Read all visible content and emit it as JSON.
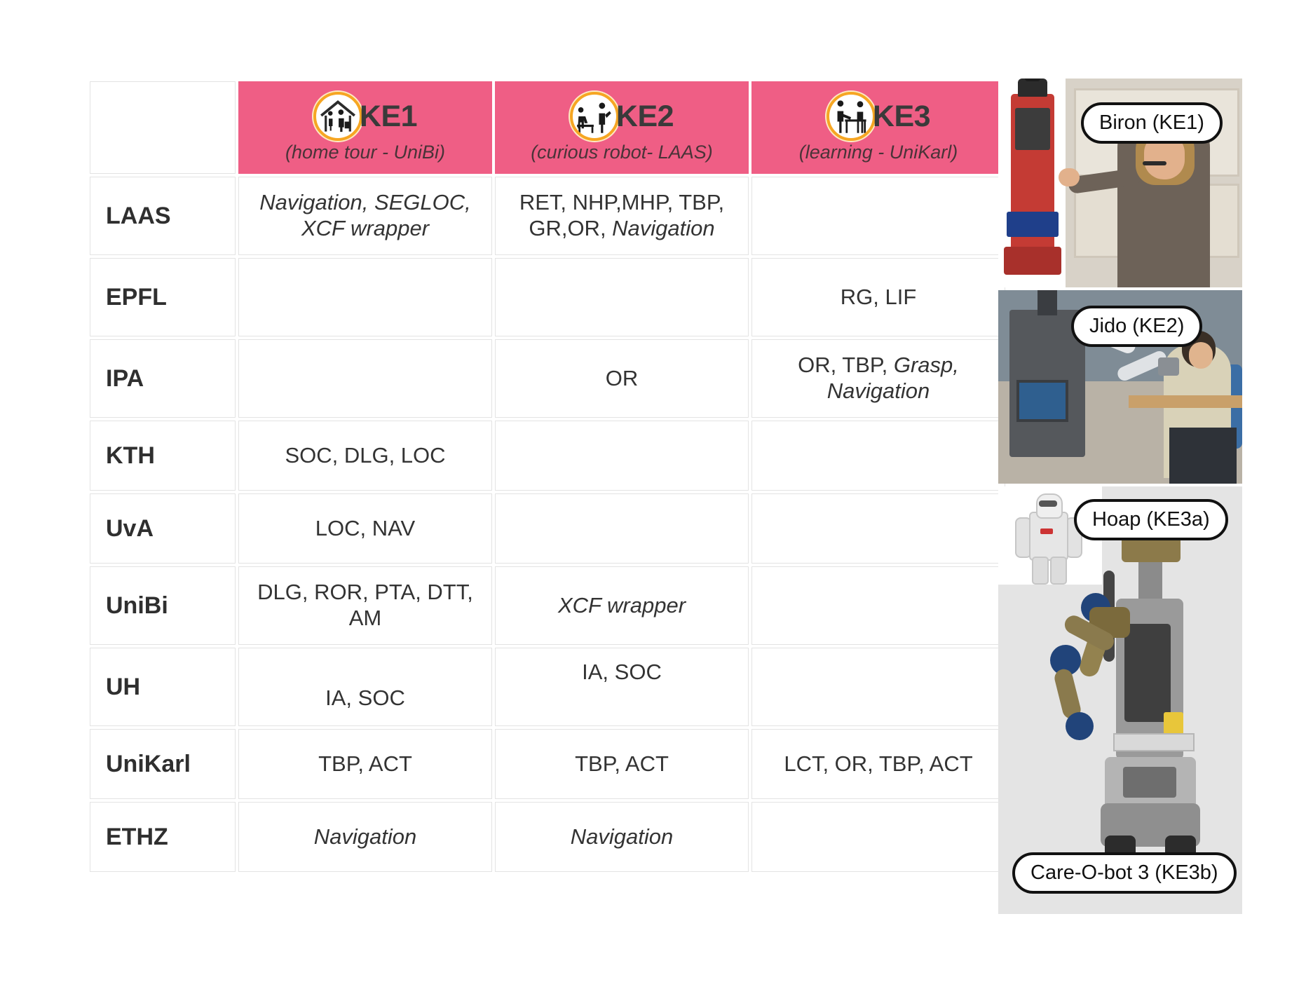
{
  "table": {
    "corner_label": "",
    "columns": [
      {
        "id": "ke1",
        "title": "KE1",
        "subtitle": "(home tour - UniBi)",
        "icon": "home-tour-icon"
      },
      {
        "id": "ke2",
        "title": "KE2",
        "subtitle": "(curious robot- LAAS)",
        "icon": "curious-robot-icon"
      },
      {
        "id": "ke3",
        "title": "KE3",
        "subtitle": "(learning - UniKarl)",
        "icon": "learning-icon"
      }
    ],
    "rows": [
      {
        "label": "LAAS",
        "cells": [
          {
            "text": "Navigation, SEGLOC, XCF wrapper",
            "shade": "light",
            "style": "italic",
            "align": "middle"
          },
          {
            "text": "RET, NHP,MHP, TBP, GR,OR, Navigation",
            "shade": "dark",
            "style": "mixed",
            "align": "middle"
          },
          {
            "text": "",
            "shade": "none",
            "style": "normal",
            "align": "middle"
          }
        ]
      },
      {
        "label": "EPFL",
        "cells": [
          {
            "text": "",
            "shade": "none",
            "style": "normal",
            "align": "middle"
          },
          {
            "text": "",
            "shade": "none",
            "style": "normal",
            "align": "middle"
          },
          {
            "text": "RG, LIF",
            "shade": "dark",
            "style": "normal",
            "align": "middle"
          }
        ]
      },
      {
        "label": "IPA",
        "cells": [
          {
            "text": "",
            "shade": "none",
            "style": "normal",
            "align": "middle"
          },
          {
            "text": "OR",
            "shade": "dark",
            "style": "normal",
            "align": "middle"
          },
          {
            "text": "OR, TBP, Grasp, Navigation",
            "shade": "dark",
            "style": "mixed",
            "align": "middle"
          }
        ]
      },
      {
        "label": "KTH",
        "cells": [
          {
            "text": "SOC, DLG, LOC",
            "shade": "dark",
            "style": "normal",
            "align": "middle"
          },
          {
            "text": "",
            "shade": "none",
            "style": "normal",
            "align": "middle"
          },
          {
            "text": "",
            "shade": "none",
            "style": "normal",
            "align": "middle"
          }
        ]
      },
      {
        "label": "UvA",
        "cells": [
          {
            "text": "LOC, NAV",
            "shade": "dark",
            "style": "normal",
            "align": "middle"
          },
          {
            "text": "",
            "shade": "none",
            "style": "normal",
            "align": "middle"
          },
          {
            "text": "",
            "shade": "none",
            "style": "normal",
            "align": "middle"
          }
        ]
      },
      {
        "label": "UniBi",
        "cells": [
          {
            "text": "DLG, ROR, PTA, DTT, AM",
            "shade": "dark",
            "style": "normal",
            "align": "middle"
          },
          {
            "text": "XCF wrapper",
            "shade": "light",
            "style": "italic",
            "align": "middle"
          },
          {
            "text": "",
            "shade": "none",
            "style": "normal",
            "align": "middle"
          }
        ]
      },
      {
        "label": "UH",
        "cells": [
          {
            "text": "IA, SOC",
            "shade": "dark",
            "style": "normal",
            "align": "bottom"
          },
          {
            "text": "IA, SOC",
            "shade": "dark",
            "style": "normal",
            "align": "top"
          },
          {
            "text": "",
            "shade": "none",
            "style": "normal",
            "align": "middle"
          }
        ]
      },
      {
        "label": "UniKarl",
        "cells": [
          {
            "text": "TBP, ACT",
            "shade": "dark",
            "style": "normal",
            "align": "middle"
          },
          {
            "text": "TBP, ACT",
            "shade": "dark",
            "style": "normal",
            "align": "middle"
          },
          {
            "text": "LCT, OR, TBP, ACT",
            "shade": "dark",
            "style": "normal",
            "align": "middle"
          }
        ]
      },
      {
        "label": "ETHZ",
        "cells": [
          {
            "text": "Navigation",
            "shade": "light",
            "style": "italic",
            "align": "middle"
          },
          {
            "text": "Navigation",
            "shade": "light",
            "style": "italic",
            "align": "middle"
          },
          {
            "text": "",
            "shade": "none",
            "style": "normal",
            "align": "middle"
          }
        ]
      }
    ]
  },
  "photos": [
    {
      "id": "biron",
      "caption": "Biron (KE1)"
    },
    {
      "id": "jido",
      "caption": "Jido (KE2)"
    },
    {
      "id": "hoap",
      "caption": "Hoap (KE3a)"
    },
    {
      "id": "cob",
      "caption": "Care-O-bot 3 (KE3b)"
    }
  ],
  "colors": {
    "header_pink": "#ef5e85",
    "cell_pink_dark": "#f291b0",
    "cell_pink_light": "#fbd6e2",
    "icon_ring": "#f6a623",
    "text_dark": "#333333",
    "border_grey": "#e3e3e3"
  }
}
